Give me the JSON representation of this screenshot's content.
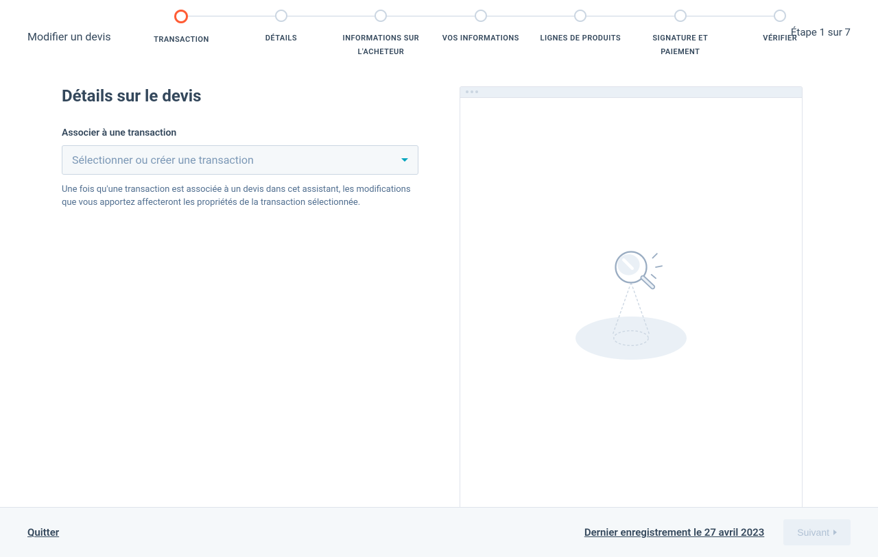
{
  "header": {
    "title": "Modifier un devis",
    "step_indicator": "Étape 1 sur 7"
  },
  "stepper": {
    "steps": [
      {
        "label": "TRANSACTION"
      },
      {
        "label": "DÉTAILS"
      },
      {
        "label": "INFORMATIONS SUR\nL'ACHETEUR"
      },
      {
        "label": "VOS INFORMATIONS"
      },
      {
        "label": "LIGNES DE PRODUITS"
      },
      {
        "label": "SIGNATURE ET\nPAIEMENT"
      },
      {
        "label": "VÉRIFIER"
      }
    ]
  },
  "main": {
    "section_title": "Détails sur le devis",
    "field_label": "Associer à une transaction",
    "select_placeholder": "Sélectionner ou créer une transaction",
    "helper_text": "Une fois qu'une transaction est associée à un devis dans cet assistant, les modifications que vous apportez affecteront les propriétés de la transaction sélectionnée."
  },
  "footer": {
    "quit_label": "Quitter",
    "last_save": "Dernier enregistrement le 27 avril 2023",
    "next_label": "Suivant"
  }
}
